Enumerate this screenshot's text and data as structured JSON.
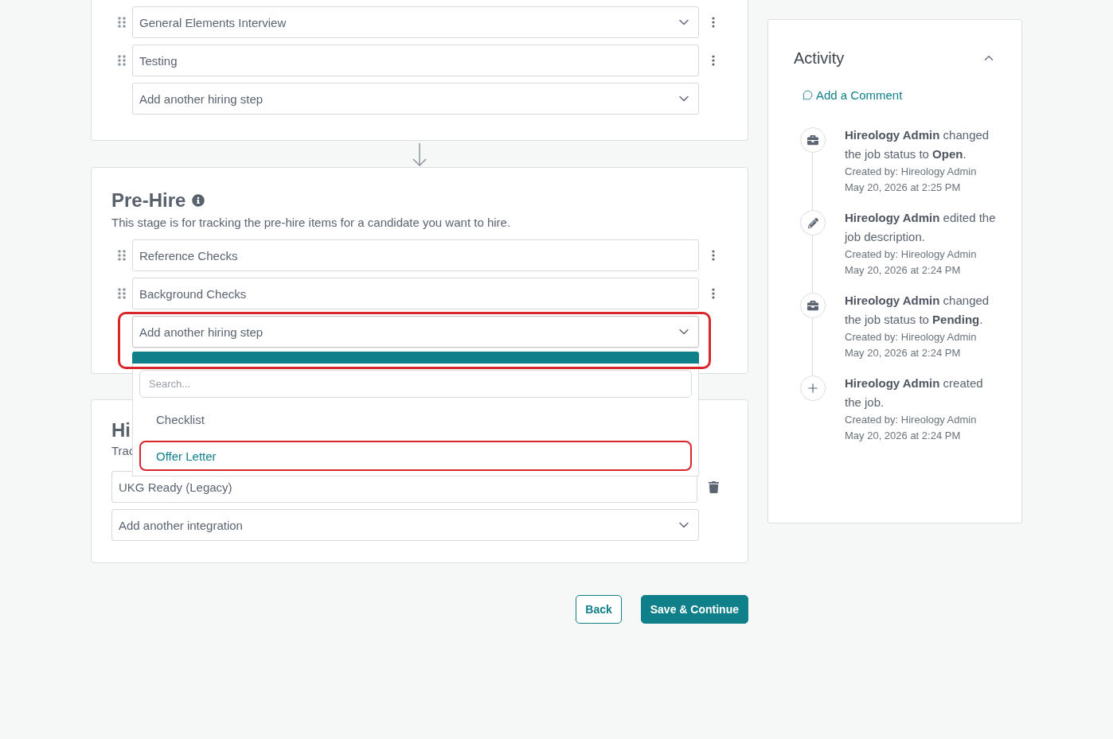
{
  "top_stage": {
    "steps": [
      {
        "label": "General Elements Interview",
        "kind": "select"
      },
      {
        "label": "Testing",
        "kind": "text"
      }
    ],
    "add_step": {
      "placeholder": "Add another hiring step"
    }
  },
  "pre_hire": {
    "title": "Pre-Hire",
    "description": "This stage is for tracking the pre-hire items for a candidate you want to hire.",
    "steps": [
      {
        "label": "Reference Checks",
        "kind": "text"
      },
      {
        "label": "Background Checks",
        "kind": "text"
      }
    ],
    "add_step": {
      "placeholder": "Add another hiring step",
      "expanded": true,
      "highlighted": true
    },
    "menu": {
      "search_placeholder": "Search...",
      "options": [
        {
          "label": "Checklist",
          "selected": false,
          "highlighted": false
        },
        {
          "label": "Offer Letter",
          "selected": true,
          "highlighted": true
        }
      ]
    }
  },
  "hire": {
    "title": "Hi",
    "description": "Trac",
    "integrations": [
      {
        "label": "UKG Ready (Legacy)"
      }
    ],
    "add_integration": {
      "placeholder": "Add another integration"
    }
  },
  "buttons": [
    {
      "label": "Back",
      "kind": "secondary"
    },
    {
      "label": "Save & Continue",
      "kind": "primary"
    }
  ],
  "activity": {
    "title": "Activity",
    "expanded": true,
    "add_comment": "Add a Comment",
    "events": [
      {
        "kind": "status",
        "text": "**Hireology Admin** changed the job status to **Open**.",
        "created_by": "Created by: Hireology Admin",
        "timestamp": "May 20, 2026 at 2:25 PM"
      },
      {
        "kind": "edit",
        "text": "**Hireology Admin** edited the job description.",
        "created_by": "Created by: Hireology Admin",
        "timestamp": "May 20, 2026 at 2:24 PM"
      },
      {
        "kind": "status",
        "text": "**Hireology Admin** changed the job status to **Pending**.",
        "created_by": "Created by: Hireology Admin",
        "timestamp": "May 20, 2026 at 2:24 PM"
      },
      {
        "kind": "create",
        "text": "**Hireology Admin** created the job.",
        "created_by": "Created by: Hireology Admin",
        "timestamp": "May 20, 2026 at 2:24 PM"
      }
    ]
  }
}
